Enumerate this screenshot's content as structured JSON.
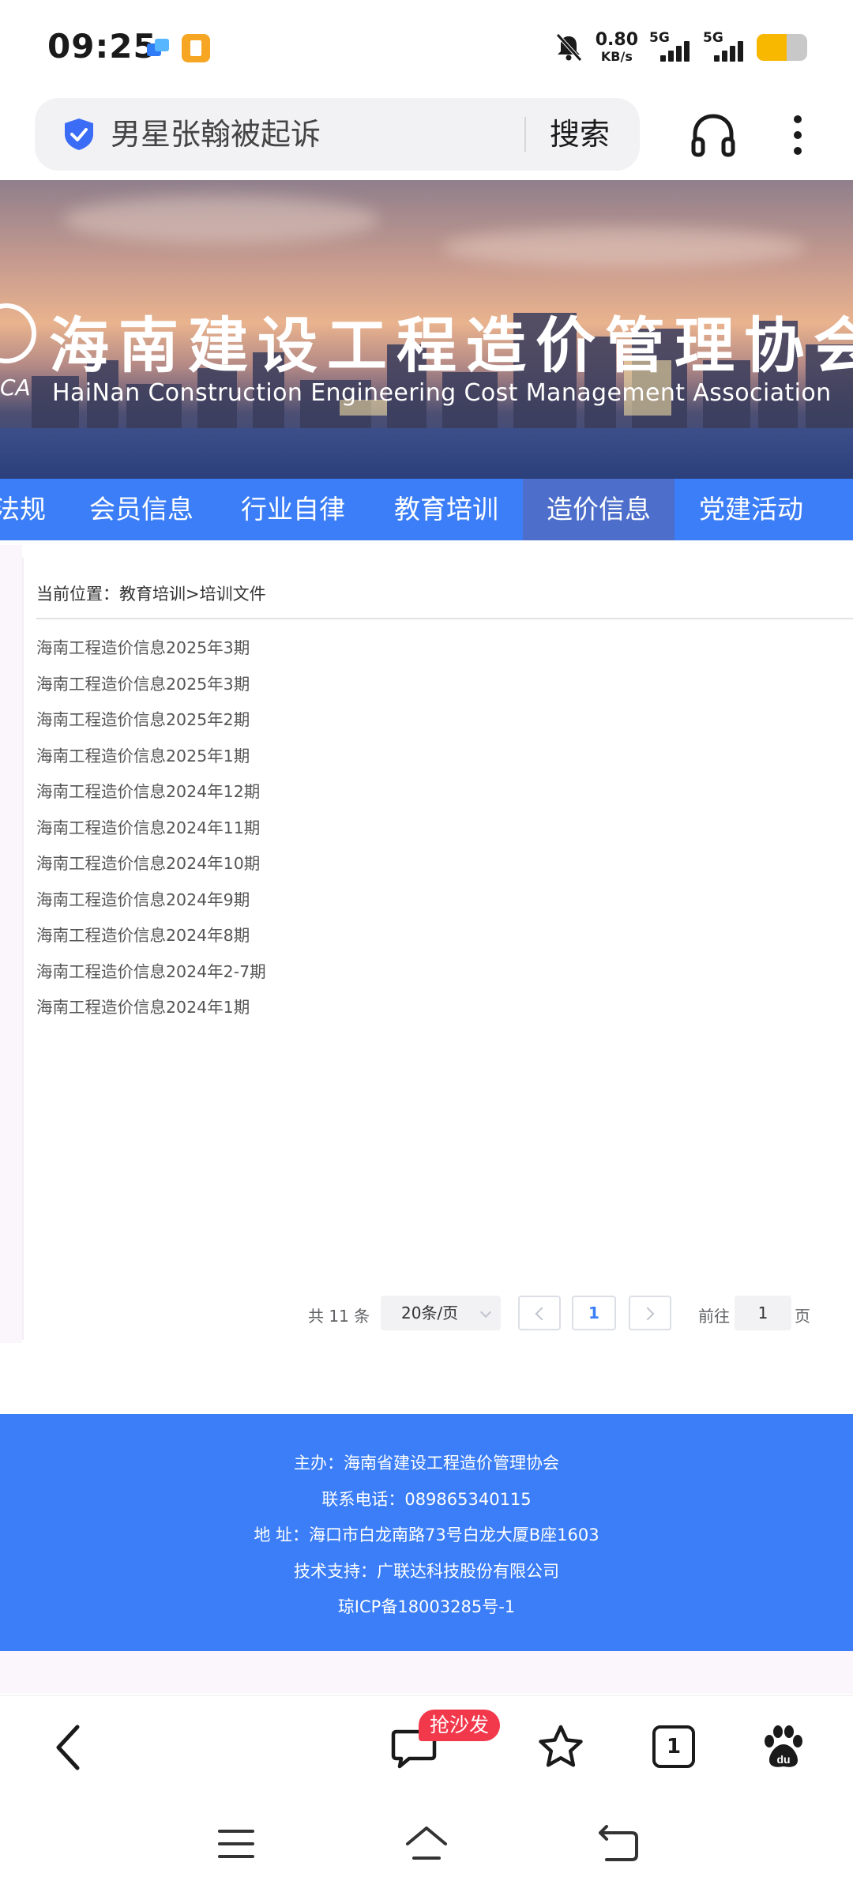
{
  "status_bar": {
    "time": "09:25",
    "net_speed_value": "0.80",
    "net_speed_unit": "KB/s",
    "signal1_label": "5G",
    "signal2_label": "5G",
    "battery_level": 0.6,
    "icons": [
      "app-notification-icon",
      "clipboard-app-icon",
      "mute-bell-icon",
      "signal-icon",
      "battery-icon"
    ]
  },
  "search": {
    "query": "男星张翰被起诉",
    "button_label": "搜索"
  },
  "banner": {
    "title_cn": "海南建设工程造价管理协会",
    "title_en": "HaiNan Construction Engineering Cost Management Association",
    "logo_abbr": "CA"
  },
  "nav": {
    "items": [
      {
        "label": "法规"
      },
      {
        "label": "会员信息"
      },
      {
        "label": "行业自律"
      },
      {
        "label": "教育培训"
      },
      {
        "label": "造价信息",
        "active": true
      },
      {
        "label": "党建活动"
      }
    ]
  },
  "breadcrumb": "当前位置：教育培训>培训文件",
  "documents": [
    "海南工程造价信息2025年3期",
    "海南工程造价信息2025年3期",
    "海南工程造价信息2025年2期",
    "海南工程造价信息2025年1期",
    "海南工程造价信息2024年12期",
    "海南工程造价信息2024年11期",
    "海南工程造价信息2024年10期",
    "海南工程造价信息2024年9期",
    "海南工程造价信息2024年8期",
    "海南工程造价信息2024年2-7期",
    "海南工程造价信息2024年1期"
  ],
  "pagination": {
    "total_label": "共 11 条",
    "page_size": "20条/页",
    "current_page": "1",
    "goto_label": "前往",
    "goto_value": "1",
    "page_suffix": "页"
  },
  "footer": {
    "host": "主办：海南省建设工程造价管理协会",
    "phone": "联系电话：089865340115",
    "address": "地 址：海口市白龙南路73号白龙大厦B座1603",
    "tech": "技术支持：广联达科技股份有限公司",
    "icp": "琼ICP备18003285号-1"
  },
  "toolbar": {
    "comment_badge": "抢沙发",
    "tab_count": "1",
    "icons": [
      "back-icon",
      "comment-icon",
      "star-icon",
      "tabs-icon",
      "baidu-paw-icon"
    ]
  },
  "accent_colors": {
    "brand_blue": "#3b7ef7",
    "nav_active": "#4d6fcb",
    "badge_red": "#f2384b"
  }
}
